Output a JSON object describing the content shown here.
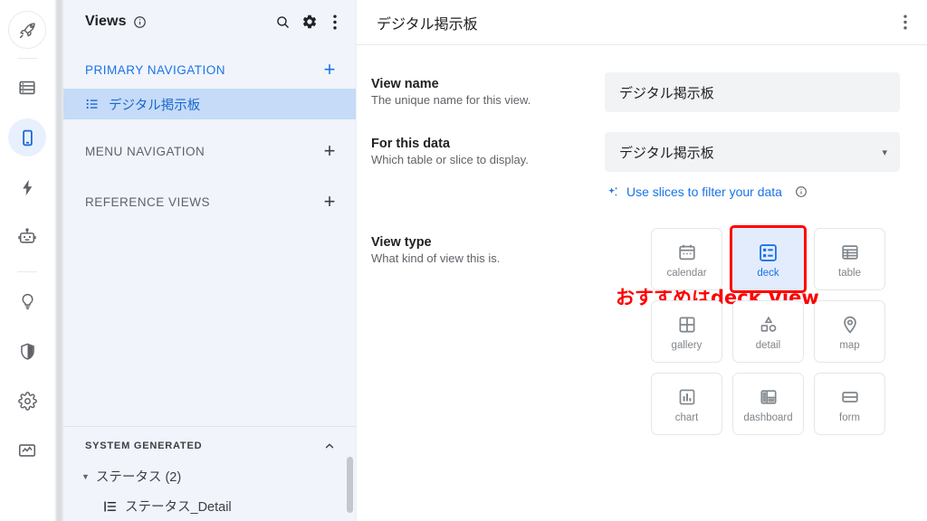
{
  "rail": {
    "items": [
      {
        "name": "rocket-icon",
        "label": "launch"
      },
      {
        "name": "database-icon",
        "label": "data"
      },
      {
        "name": "mobile-device-icon",
        "label": "app",
        "active": true
      },
      {
        "name": "lightning-bolt-icon",
        "label": "automation"
      },
      {
        "name": "robot-icon",
        "label": "intelligence"
      },
      {
        "name": "lightbulb-icon",
        "label": "ideas"
      },
      {
        "name": "shield-icon",
        "label": "security"
      },
      {
        "name": "gear-icon",
        "label": "settings"
      },
      {
        "name": "monitor-chart-icon",
        "label": "monitor"
      }
    ]
  },
  "sidebar": {
    "title": "Views",
    "header_icons": [
      "search-icon",
      "gear-icon",
      "more-vert-icon"
    ],
    "sections": [
      {
        "label": "PRIMARY NAVIGATION",
        "add": "+"
      },
      {
        "label": "MENU NAVIGATION",
        "add": "+"
      },
      {
        "label": "REFERENCE VIEWS",
        "add": "+"
      }
    ],
    "primary_items": [
      {
        "label": "デジタル掲示板",
        "icon": "list-view-icon",
        "selected": true
      }
    ],
    "system_generated": {
      "label": "SYSTEM GENERATED",
      "collapse": "chevron-up-icon",
      "groups": [
        {
          "label": "ステータス (2)",
          "expander": "▼"
        }
      ],
      "children": [
        {
          "label": "ステータス_Detail",
          "icon": "detail-view-icon"
        }
      ]
    }
  },
  "main": {
    "title": "デジタル掲示板",
    "more_icon": "more-vert-icon",
    "fields": {
      "view_name": {
        "title": "View name",
        "subtitle": "The unique name for this view.",
        "value": "デジタル掲示板",
        "placeholder": "View name"
      },
      "for_this_data": {
        "title": "For this data",
        "subtitle": "Which table or slice to display.",
        "value": "デジタル掲示板",
        "caret": "▾"
      },
      "slices": {
        "link": "Use slices to filter your data",
        "sparkle_icon": "sparkle-icon",
        "info_icon": "info-icon"
      },
      "view_type": {
        "title": "View type",
        "subtitle": "What kind of view this is.",
        "options": [
          {
            "label": "calendar",
            "icon": "calendar-icon",
            "selected": false
          },
          {
            "label": "deck",
            "icon": "deck-icon",
            "selected": true
          },
          {
            "label": "table",
            "icon": "table-icon",
            "selected": false
          },
          {
            "label": "gallery",
            "icon": "gallery-icon",
            "selected": false
          },
          {
            "label": "detail",
            "icon": "detail-icon",
            "selected": false
          },
          {
            "label": "map",
            "icon": "map-pin-icon",
            "selected": false
          },
          {
            "label": "chart",
            "icon": "chart-icon",
            "selected": false
          },
          {
            "label": "dashboard",
            "icon": "dashboard-icon",
            "selected": false
          },
          {
            "label": "form",
            "icon": "form-icon",
            "selected": false
          }
        ]
      }
    }
  },
  "annotation": {
    "text": "おすすめはdeck View",
    "color": "#ff0000",
    "highlight_target": "deck"
  },
  "colors": {
    "accent_blue": "#1a73e8",
    "selected_nav_bg": "#c5dbf7",
    "sidebar_bg": "#f1f4fb",
    "input_bg": "#f1f3f4",
    "annotation_red": "#ff0000",
    "deck_selected_bg": "#e2ecfd"
  }
}
